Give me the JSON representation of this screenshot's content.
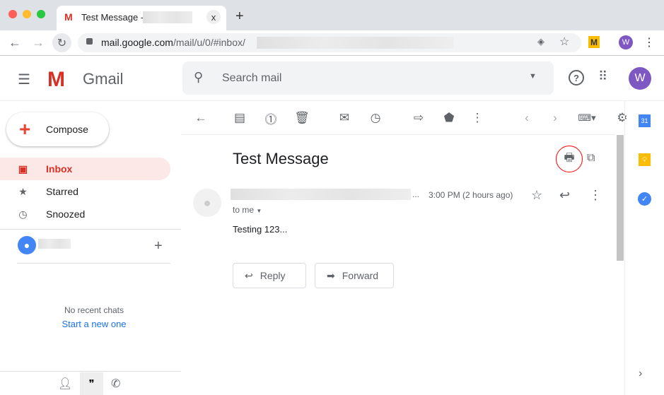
{
  "browser": {
    "tab_title": "Test Message -",
    "url_host": "mail.google.com",
    "url_path": "/mail/u/0/#inbox/",
    "profile_initial": "W",
    "new_tab": "+",
    "close": "x"
  },
  "header": {
    "app_name": "Gmail",
    "search_placeholder": "Search mail",
    "avatar_initial": "W"
  },
  "sidebar": {
    "compose": "Compose",
    "items": [
      {
        "label": "Inbox",
        "icon": "inbox-icon",
        "active": true
      },
      {
        "label": "Starred",
        "icon": "star-icon"
      },
      {
        "label": "Snoozed",
        "icon": "clock-icon"
      }
    ],
    "no_chats": "No recent chats",
    "start_chat": "Start a new one"
  },
  "message": {
    "subject": "Test Message",
    "time": "3:00 PM (2 hours ago)",
    "to": "to me",
    "body": "Testing 123...",
    "ellipsis": "...",
    "reply": "Reply",
    "forward": "Forward"
  },
  "colors": {
    "accent_red": "#d93025",
    "link": "#1a73e8",
    "avatar": "#7e57c2",
    "highlight_circle": "#ff0000"
  }
}
